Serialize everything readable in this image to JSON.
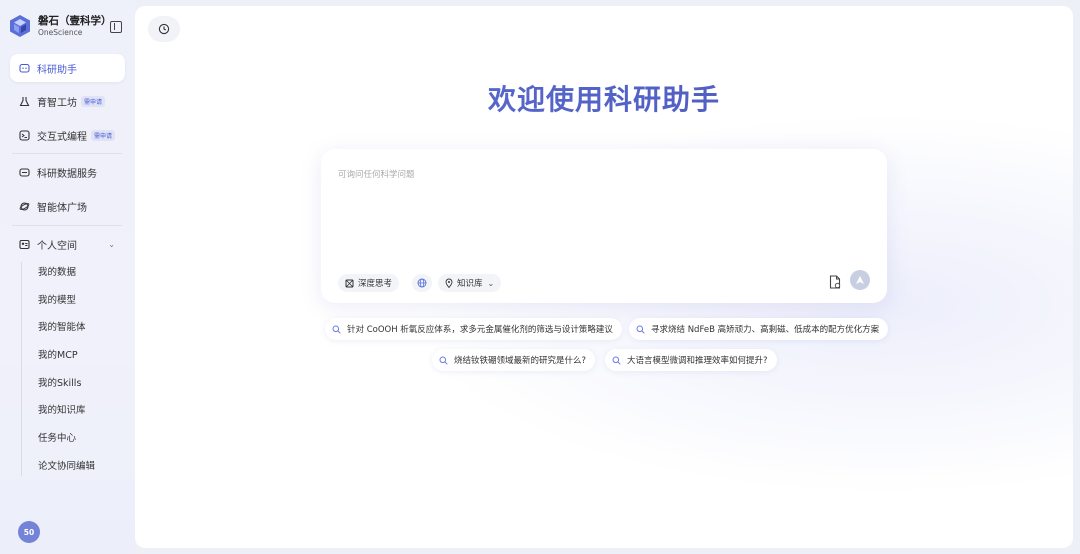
{
  "brand": {
    "name": "磐石（壹科学）",
    "sub": "OneScience",
    "logo_icon": "onescience-logo",
    "accent": "#4a5bd4"
  },
  "nav": {
    "items": [
      {
        "label": "科研助手",
        "icon": "chat-bubble-icon",
        "active": true
      },
      {
        "label": "育智工坊",
        "icon": "flask-icon",
        "badge": "需申请"
      },
      {
        "label": "交互式编程",
        "icon": "terminal-icon",
        "badge": "需申请"
      },
      {
        "label": "科研数据服务",
        "icon": "database-icon"
      },
      {
        "label": "智能体广场",
        "icon": "planet-icon"
      },
      {
        "label": "个人空间",
        "icon": "user-card-icon",
        "expanded": true
      }
    ],
    "personal": [
      "我的数据",
      "我的模型",
      "我的智能体",
      "我的MCP",
      "我的Skills",
      "我的知识库",
      "任务中心",
      "论文协同编辑"
    ]
  },
  "user": {
    "avatar_text": "50"
  },
  "main": {
    "title": "欢迎使用科研助手",
    "input": {
      "placeholder": "可询问任何科学问题"
    },
    "tools": {
      "deep_think": "深度思考",
      "knowledge": "知识库"
    },
    "suggestions": [
      "针对 CoOOH 析氧反应体系，求多元金属催化剂的筛选与设计策略建议",
      "寻求烧结 NdFeB 高矫顽力、高剩磁、低成本的配方优化方案",
      "烧结钕铁硼领域最新的研究是什么?",
      "大语言模型微调和推理效率如何提升?"
    ]
  }
}
